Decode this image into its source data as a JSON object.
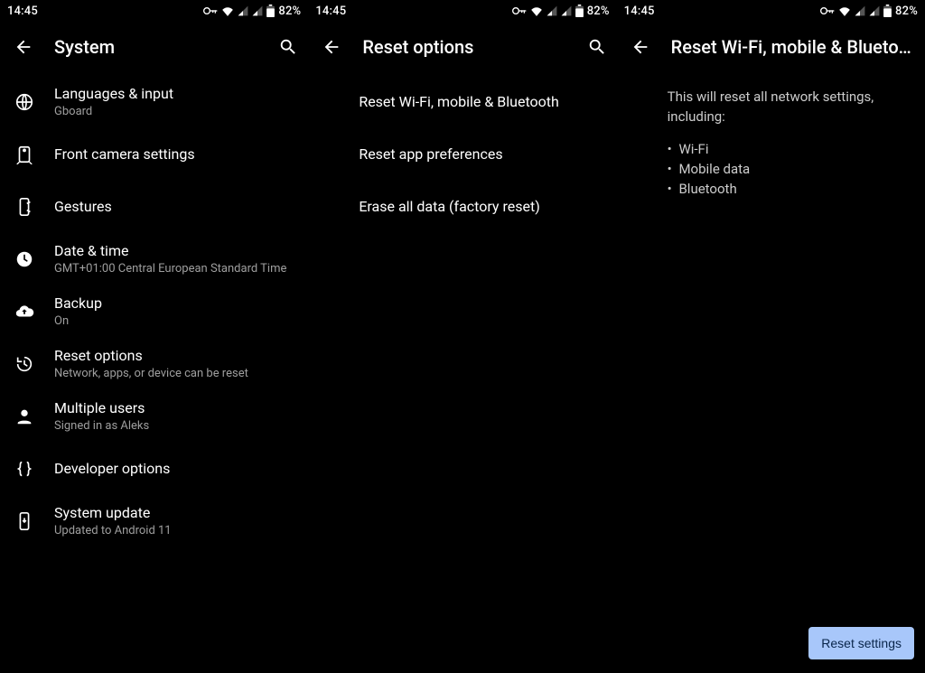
{
  "status": {
    "time": "14:45",
    "battery_text": "82%"
  },
  "screen1": {
    "title": "System",
    "items": [
      {
        "title": "Languages & input",
        "sub": "Gboard"
      },
      {
        "title": "Front camera settings",
        "sub": ""
      },
      {
        "title": "Gestures",
        "sub": ""
      },
      {
        "title": "Date & time",
        "sub": "GMT+01:00 Central European Standard Time"
      },
      {
        "title": "Backup",
        "sub": "On"
      },
      {
        "title": "Reset options",
        "sub": "Network, apps, or device can be reset"
      },
      {
        "title": "Multiple users",
        "sub": "Signed in as Aleks"
      },
      {
        "title": "Developer options",
        "sub": ""
      },
      {
        "title": "System update",
        "sub": "Updated to Android 11"
      }
    ]
  },
  "screen2": {
    "title": "Reset options",
    "items": [
      {
        "title": "Reset Wi-Fi, mobile & Bluetooth"
      },
      {
        "title": "Reset app preferences"
      },
      {
        "title": "Erase all data (factory reset)"
      }
    ]
  },
  "screen3": {
    "title": "Reset Wi-Fi, mobile & Blueto…",
    "intro": "This will reset all network settings, including:",
    "bullets": [
      "Wi-Fi",
      "Mobile data",
      "Bluetooth"
    ],
    "cta": "Reset settings"
  }
}
